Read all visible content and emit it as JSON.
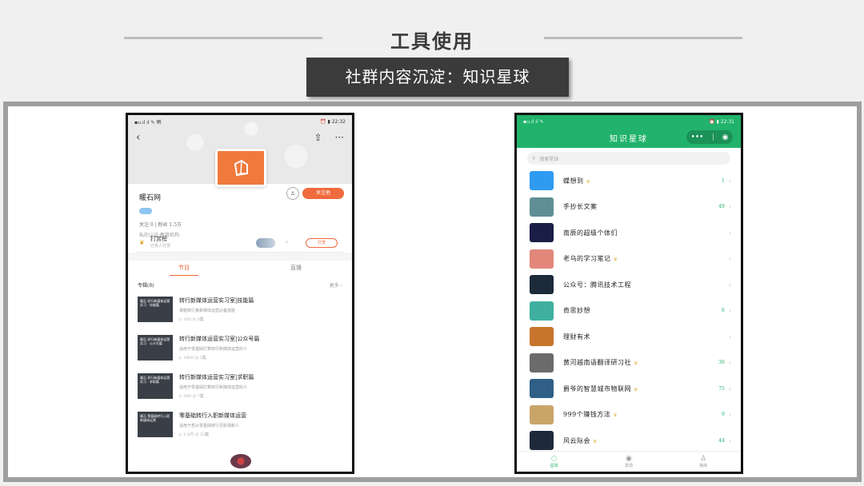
{
  "slide": {
    "title": "工具使用",
    "subtitle": "社群内容沉淀：知识星球"
  },
  "left_phone": {
    "status_left": "▪▫.ıl ıl ✎ 咧",
    "status_right": "⏰ ▮ 22:32",
    "nav": {
      "back_icon": "‹",
      "share_icon": "⇧",
      "more_icon": "···"
    },
    "profile": {
      "name": "暖石网",
      "stats": "关注  0   |   粉丝  1.5万",
      "desc": "私的认证:教育机构",
      "follow_btn": "关注他"
    },
    "rank": {
      "title": "打赏榜",
      "sub": "已有人打赏",
      "arrow": "›",
      "reward_btn": "打赏"
    },
    "tabs": [
      {
        "label": "节目"
      },
      {
        "label": "直播"
      }
    ],
    "section": {
      "title": "专辑(8)",
      "more": "更多 ›"
    },
    "courses": [
      {
        "thumb": "暖石 初行新媒体运营实习 · 技能篇",
        "title": "转行新媒体运营实习室|技能篇",
        "desc": "掌握转行某新媒体运营必备技能",
        "meta": "▷ 303   ◷ 3集"
      },
      {
        "thumb": "暖石 初行新媒体运营实习 · 公众号篇",
        "title": "转行新媒体运营实习室|公众号篇",
        "desc": "适用于零基础打算转行新媒体运营的人",
        "meta": "▷ 1805   ◷ 5集"
      },
      {
        "thumb": "暖石 初行新媒体运营实习 · 求职篇",
        "title": "转行新媒体运营实习室|求职篇",
        "desc": "适用于零基础打算转行新媒体运营的人",
        "meta": "▷ 389   ◷ 7集"
      },
      {
        "thumb": "暖石 零基础转行入职新媒体运营",
        "title": "零基础转行入职新媒体运营",
        "desc": "适用于想从零基础转行至职场新人",
        "meta": "▷ 2.8万   ◷ 33集"
      }
    ]
  },
  "right_phone": {
    "status_left": "▪▫.ıl ıl ✎",
    "status_right": "⏰ ▮ 22:31",
    "title": "知识星球",
    "capsule": {
      "dots": "•••",
      "target": "◉"
    },
    "search_placeholder": "搜索星球",
    "planets": [
      {
        "name": "蝶想到",
        "crown": "♛",
        "count": "1",
        "color": "#2f9bf0",
        "icon": "ghost-icon"
      },
      {
        "name": "手抄长文案",
        "crown": "",
        "count": "49",
        "color": "#5f8f94",
        "icon": "arrow-icon"
      },
      {
        "name": "南辰的超级个体们",
        "crown": "",
        "count": "",
        "color": "#1a1d45",
        "icon": "galaxy-icon"
      },
      {
        "name": "老乌的学习笔记",
        "crown": "♛",
        "count": "",
        "color": "#e2877a",
        "icon": "book-icon"
      },
      {
        "name": "公众号：腾讯技术工程",
        "crown": "",
        "count": "",
        "color": "#1c2b3a",
        "icon": "penguin-icon"
      },
      {
        "name": "奇思妙想",
        "crown": "",
        "count": "6",
        "color": "#3fb0a0",
        "icon": "idea-icon"
      },
      {
        "name": "理财有术",
        "crown": "",
        "count": "",
        "color": "#c8742c",
        "icon": "finance-icon"
      },
      {
        "name": "黄河越南语翻译研习社",
        "crown": "♛",
        "count": "36",
        "color": "#6b6b6b",
        "icon": "river-icon"
      },
      {
        "name": "爵爷的智慧城市物联网",
        "crown": "♛",
        "count": "75",
        "color": "#2f5f86",
        "icon": "city-icon"
      },
      {
        "name": "999个赚钱方法",
        "crown": "♛",
        "count": "9",
        "color": "#c9a56a",
        "icon": "coin-icon"
      },
      {
        "name": "风云际会",
        "crown": "♛",
        "count": "44",
        "color": "#1e2a3a",
        "icon": "cloud-icon"
      }
    ],
    "bottom_tabs": [
      {
        "label": "星球",
        "icon": "◌",
        "name": "planet-tab-icon"
      },
      {
        "label": "发现",
        "icon": "◉",
        "name": "eye-icon"
      },
      {
        "label": "我的",
        "icon": "♙",
        "name": "user-icon"
      }
    ]
  },
  "colors": {
    "green": "#21b36c",
    "orange": "#ef6a3c",
    "dark_box": "#3b3b3b"
  }
}
